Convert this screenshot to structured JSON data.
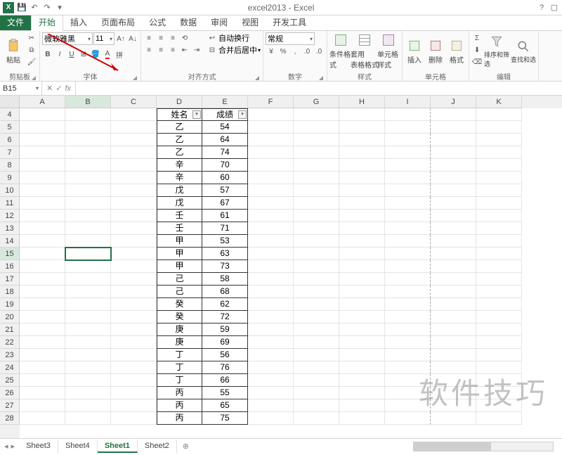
{
  "app": {
    "title": "excel2013 - Excel"
  },
  "qat": {
    "save": "💾",
    "undo": "↶",
    "redo": "↷"
  },
  "tabs": {
    "file": "文件",
    "home": "开始",
    "insert": "插入",
    "layout": "页面布局",
    "formulas": "公式",
    "data": "数据",
    "review": "审阅",
    "view": "视图",
    "dev": "开发工具"
  },
  "ribbon": {
    "clipboard": {
      "paste": "粘贴",
      "label": "剪贴板"
    },
    "font": {
      "name": "微软雅黑",
      "size": "11",
      "bold": "B",
      "italic": "I",
      "underline": "U",
      "label": "字体"
    },
    "align": {
      "wrap": "自动换行",
      "merge": "合并后居中",
      "label": "对齐方式"
    },
    "number": {
      "format": "常规",
      "label": "数字"
    },
    "styles": {
      "cond": "条件格式",
      "table": "套用\n表格格式",
      "cell": "单元格样式",
      "label": "样式"
    },
    "cells": {
      "insert": "插入",
      "delete": "删除",
      "format": "格式",
      "label": "单元格"
    },
    "editing": {
      "sort": "排序和筛选",
      "find": "查找和选",
      "label": "编辑"
    }
  },
  "namebox": {
    "ref": "B15"
  },
  "columns": [
    "A",
    "B",
    "C",
    "D",
    "E",
    "F",
    "G",
    "H",
    "I",
    "J",
    "K"
  ],
  "row_start": 4,
  "row_end": 28,
  "header": {
    "d": "姓名",
    "e": "成绩"
  },
  "data": [
    {
      "d": "乙",
      "e": "54"
    },
    {
      "d": "乙",
      "e": "64"
    },
    {
      "d": "乙",
      "e": "74"
    },
    {
      "d": "辛",
      "e": "70"
    },
    {
      "d": "辛",
      "e": "60"
    },
    {
      "d": "戊",
      "e": "57"
    },
    {
      "d": "戊",
      "e": "67"
    },
    {
      "d": "壬",
      "e": "61"
    },
    {
      "d": "壬",
      "e": "71"
    },
    {
      "d": "甲",
      "e": "53"
    },
    {
      "d": "甲",
      "e": "63"
    },
    {
      "d": "甲",
      "e": "73"
    },
    {
      "d": "己",
      "e": "58"
    },
    {
      "d": "己",
      "e": "68"
    },
    {
      "d": "癸",
      "e": "62"
    },
    {
      "d": "癸",
      "e": "72"
    },
    {
      "d": "庚",
      "e": "59"
    },
    {
      "d": "庚",
      "e": "69"
    },
    {
      "d": "丁",
      "e": "56"
    },
    {
      "d": "丁",
      "e": "76"
    },
    {
      "d": "丁",
      "e": "66"
    },
    {
      "d": "丙",
      "e": "55"
    },
    {
      "d": "丙",
      "e": "65"
    },
    {
      "d": "丙",
      "e": "75"
    }
  ],
  "sheets": {
    "items": [
      "Sheet3",
      "Sheet4",
      "Sheet1",
      "Sheet2"
    ],
    "active": 2
  },
  "active_cell": {
    "row": 15,
    "col": 1
  },
  "watermark": "软件技巧"
}
